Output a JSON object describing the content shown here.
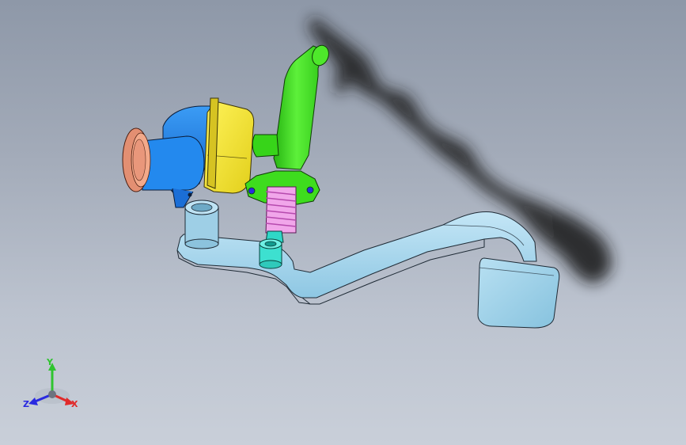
{
  "viewport": {
    "background_top": "#8e98a8",
    "background_bottom": "#c9cfd9"
  },
  "model": {
    "parts": [
      {
        "name": "pedal-arm",
        "color": "#a9d8ef"
      },
      {
        "name": "pedal-pad",
        "color": "#a9d8ef"
      },
      {
        "name": "pivot-bushing",
        "color": "#a9d8ef"
      },
      {
        "name": "push-rod-clevis",
        "color": "#3de0d0"
      },
      {
        "name": "return-spring",
        "color": "#e98de0"
      },
      {
        "name": "master-cylinder",
        "color": "#3edc1e"
      },
      {
        "name": "reservoir-body",
        "color": "#f5e83a"
      },
      {
        "name": "booster-housing",
        "color": "#1e7de6"
      },
      {
        "name": "mounting-flange",
        "color": "#e9967a"
      }
    ]
  },
  "triad": {
    "y_label": "Y",
    "z_label": "Z",
    "x_label": "X",
    "y_color": "#2fc42f",
    "z_color": "#2a2ae0",
    "x_color": "#e02a2a"
  }
}
